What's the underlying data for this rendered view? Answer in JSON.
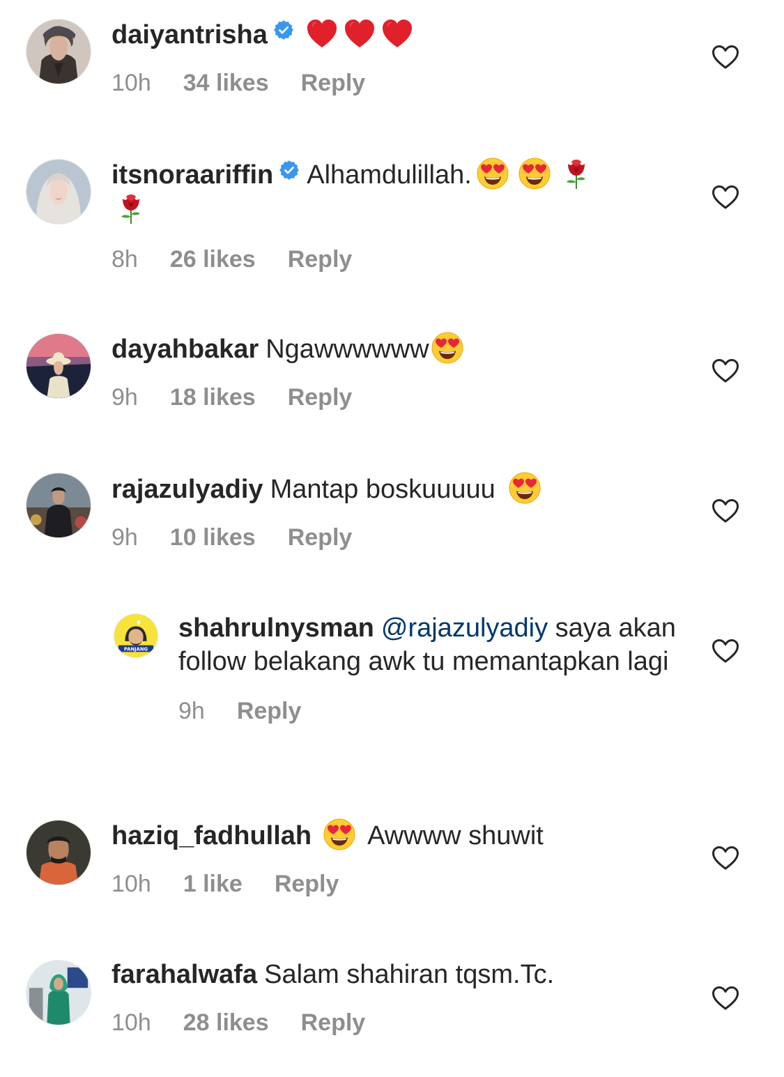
{
  "comments": [
    {
      "username": "daiyantrisha",
      "verified": true,
      "text": "",
      "emojis_after": [
        "heart-emoji",
        "heart-emoji",
        "heart-emoji"
      ],
      "time": "10h",
      "likes": "34 likes",
      "reply": "Reply"
    },
    {
      "username": "itsnoraariffin",
      "verified": true,
      "text": "Alhamdulillah.",
      "emojis_after": [
        "heart-eyes-emoji",
        "heart-eyes-emoji",
        "rose-emoji",
        "rose-emoji"
      ],
      "time": "8h",
      "likes": "26 likes",
      "reply": "Reply"
    },
    {
      "username": "dayahbakar",
      "verified": false,
      "text": "Ngawwwwww",
      "emojis_after": [
        "heart-eyes-emoji"
      ],
      "time": "9h",
      "likes": "18 likes",
      "reply": "Reply"
    },
    {
      "username": "rajazulyadiy",
      "verified": false,
      "text": "Mantap boskuuuuu",
      "emojis_after": [
        "heart-eyes-emoji"
      ],
      "time": "9h",
      "likes": "10 likes",
      "reply": "Reply"
    },
    {
      "username": "shahrulnysman",
      "verified": false,
      "is_reply": true,
      "mention": "@rajazulyadiy",
      "text": "saya akan follow belakang awk tu memantapkan lagi",
      "avatar_badge": "PANJANG",
      "time": "9h",
      "likes": "",
      "reply": "Reply"
    },
    {
      "username": "haziq_fadhullah",
      "verified": false,
      "emojis_before": [
        "heart-eyes-emoji"
      ],
      "text": "Awwww shuwit",
      "time": "10h",
      "likes": "1 like",
      "reply": "Reply"
    },
    {
      "username": "farahalwafa",
      "verified": false,
      "text": "Salam shahiran tqsm.Tc.",
      "time": "10h",
      "likes": "28 likes",
      "reply": "Reply"
    }
  ],
  "colors": {
    "text": "#262626",
    "meta": "#8e8e8e",
    "mention": "#00376b",
    "verified": "#3897f0",
    "heart": "#262626"
  }
}
